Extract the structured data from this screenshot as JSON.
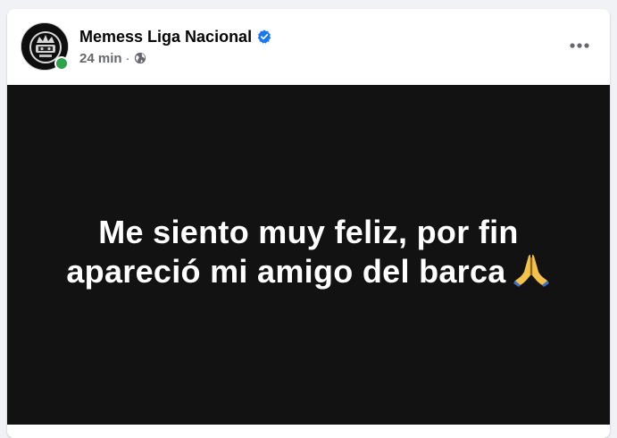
{
  "post": {
    "author": {
      "name": "Memess Liga Nacional",
      "verified_icon": "verified-badge-icon",
      "online": true,
      "avatar_icon": "page-avatar-icon"
    },
    "meta": {
      "time": "24 min",
      "separator": "·",
      "audience_icon": "globe-icon"
    },
    "menu_icon": "more-options-icon",
    "media": {
      "text_line1": "Me siento muy feliz, por fin",
      "text_line2": "apareció mi amigo del barca",
      "emoji": "🙏",
      "background": "#121212",
      "text_color": "#ffffff"
    }
  },
  "colors": {
    "accent_blue": "#1877f2",
    "online_green": "#31a24c",
    "secondary_text": "#65676b",
    "page_bg": "#f0f2f5"
  }
}
